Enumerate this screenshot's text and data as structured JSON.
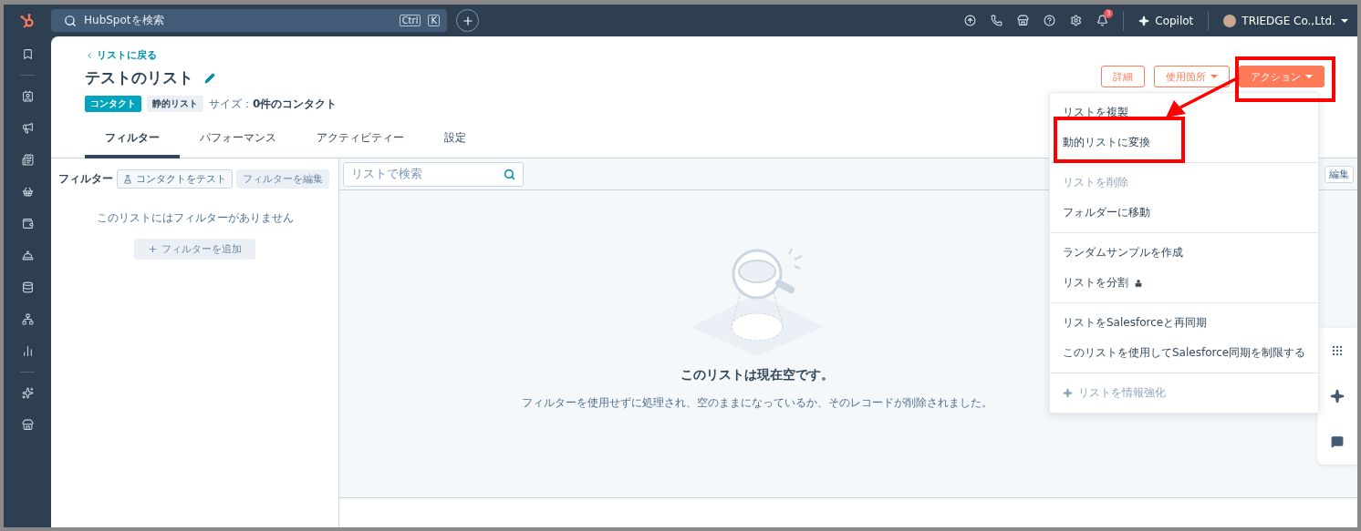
{
  "topbar": {
    "search": {
      "placeholder": "HubSpotを検索",
      "keys": [
        "Ctrl",
        "K"
      ]
    },
    "notifications": "3",
    "copilot": "Copilot",
    "account": "TRIEDGE Co.,Ltd."
  },
  "header": {
    "back_link": "リストに戻る",
    "title": "テストのリスト",
    "tags": [
      {
        "label": "コンタクト",
        "kind": "object"
      },
      {
        "label": "静的リスト",
        "kind": "type"
      }
    ],
    "size_label": "サイズ：",
    "size_value": "0件のコンタクト",
    "buttons": [
      {
        "label": "詳細",
        "kind": "outline",
        "caret": false
      },
      {
        "label": "使用箇所",
        "kind": "outline",
        "caret": true
      },
      {
        "label": "アクション",
        "kind": "primary",
        "caret": true
      }
    ]
  },
  "tabs": [
    {
      "label": "フィルター",
      "selected": true
    },
    {
      "label": "パフォーマンス",
      "selected": false
    },
    {
      "label": "アクティビティー",
      "selected": false
    },
    {
      "label": "設定",
      "selected": false
    }
  ],
  "filter_panel": {
    "title": "フィルター",
    "test_button": "コンタクトをテスト",
    "edit_button": {
      "label": "フィルターを編集",
      "disabled": true
    },
    "empty_text": "このリストにはフィルターがありません",
    "add_button": {
      "label": "フィルターを追加",
      "disabled": true
    }
  },
  "list_panel": {
    "search": {
      "placeholder": "リストで検索"
    },
    "edit_button": "編集",
    "empty_title": "このリストは現在空です。",
    "empty_text": "フィルターを使用せずに処理され、空のままになっているか、そのレコードが削除されました。"
  },
  "actions_menu": {
    "groups": [
      {
        "items": [
          {
            "label": "リストを複製",
            "disabled": false,
            "kind": "plain"
          },
          {
            "label": "動的リストに変換",
            "disabled": false,
            "kind": "plain"
          }
        ]
      },
      {
        "items": [
          {
            "label": "リストを削除",
            "disabled": true,
            "kind": "plain"
          },
          {
            "label": "フォルダーに移動",
            "disabled": false,
            "kind": "plain"
          }
        ]
      },
      {
        "items": [
          {
            "label": "ランダムサンプルを作成",
            "disabled": false,
            "kind": "plain"
          },
          {
            "label": "リストを分割",
            "disabled": false,
            "kind": "locked"
          }
        ]
      },
      {
        "items": [
          {
            "label": "リストをSalesforceと再同期",
            "disabled": false,
            "kind": "plain"
          },
          {
            "label": "このリストを使用してSalesforce同期を制限する",
            "disabled": false,
            "kind": "plain"
          }
        ]
      },
      {
        "items": [
          {
            "label": "リストを情報強化",
            "disabled": true,
            "kind": "ai"
          }
        ]
      }
    ]
  }
}
